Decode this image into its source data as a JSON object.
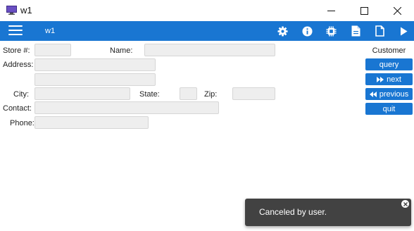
{
  "window": {
    "title": "w1",
    "icons": [
      "app-monitor-icon",
      "minimize-icon",
      "maximize-icon",
      "close-icon"
    ]
  },
  "toolbar": {
    "title": "w1",
    "accent": "#1976d2",
    "icons": [
      "menu-icon",
      "gear-icon",
      "info-icon",
      "chip-icon",
      "document-icon",
      "file-icon",
      "play-icon"
    ]
  },
  "form": {
    "store_label": "Store #:",
    "name_label": "Name:",
    "address_label": "Address:",
    "city_label": "City:",
    "state_label": "State:",
    "zip_label": "Zip:",
    "contact_label": "Contact:",
    "phone_label": "Phone:",
    "values": {
      "store": "",
      "name": "",
      "address1": "",
      "address2": "",
      "city": "",
      "state": "",
      "zip": "",
      "contact": "",
      "phone": ""
    }
  },
  "side": {
    "title": "Customer",
    "query": "query",
    "next": "next",
    "previous": "previous",
    "quit": "quit"
  },
  "toast": {
    "message": "Canceled by user.",
    "background": "#424242"
  }
}
